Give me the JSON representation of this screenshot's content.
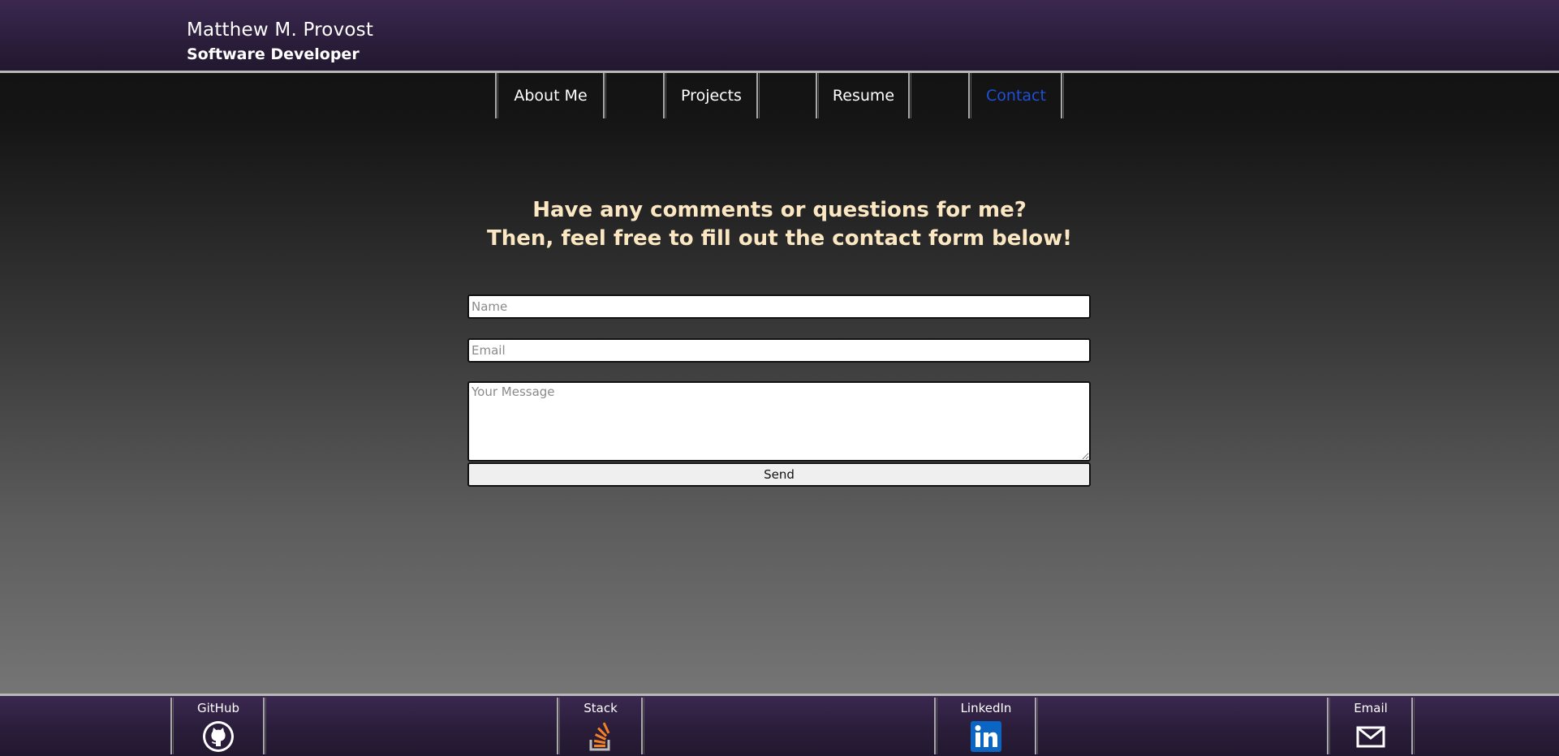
{
  "header": {
    "name": "Matthew M. Provost",
    "title": "Software Developer"
  },
  "nav": {
    "items": [
      {
        "label": "About Me"
      },
      {
        "label": "Projects"
      },
      {
        "label": "Resume"
      },
      {
        "label": "Contact",
        "active": true
      }
    ],
    "active_color": "#1e50d8"
  },
  "contact": {
    "heading_line1": "Have any comments or questions for me?",
    "heading_line2": "Then, feel free to fill out the contact form below!",
    "name_placeholder": "Name",
    "email_placeholder": "Email",
    "message_placeholder": "Your Message",
    "send_label": "Send"
  },
  "footer": {
    "links": [
      {
        "label": "GitHub",
        "icon": "github-octocat-icon"
      },
      {
        "label": "Stack",
        "icon": "stackoverflow-icon"
      },
      {
        "label": "LinkedIn",
        "icon": "linkedin-icon"
      },
      {
        "label": "Email",
        "icon": "envelope-icon"
      }
    ]
  },
  "colors": {
    "header_purple": "#2a1d3a",
    "heading_text": "#fbe8c3",
    "linkedin_blue": "#0a66c2",
    "stack_orange": "#f48024"
  }
}
